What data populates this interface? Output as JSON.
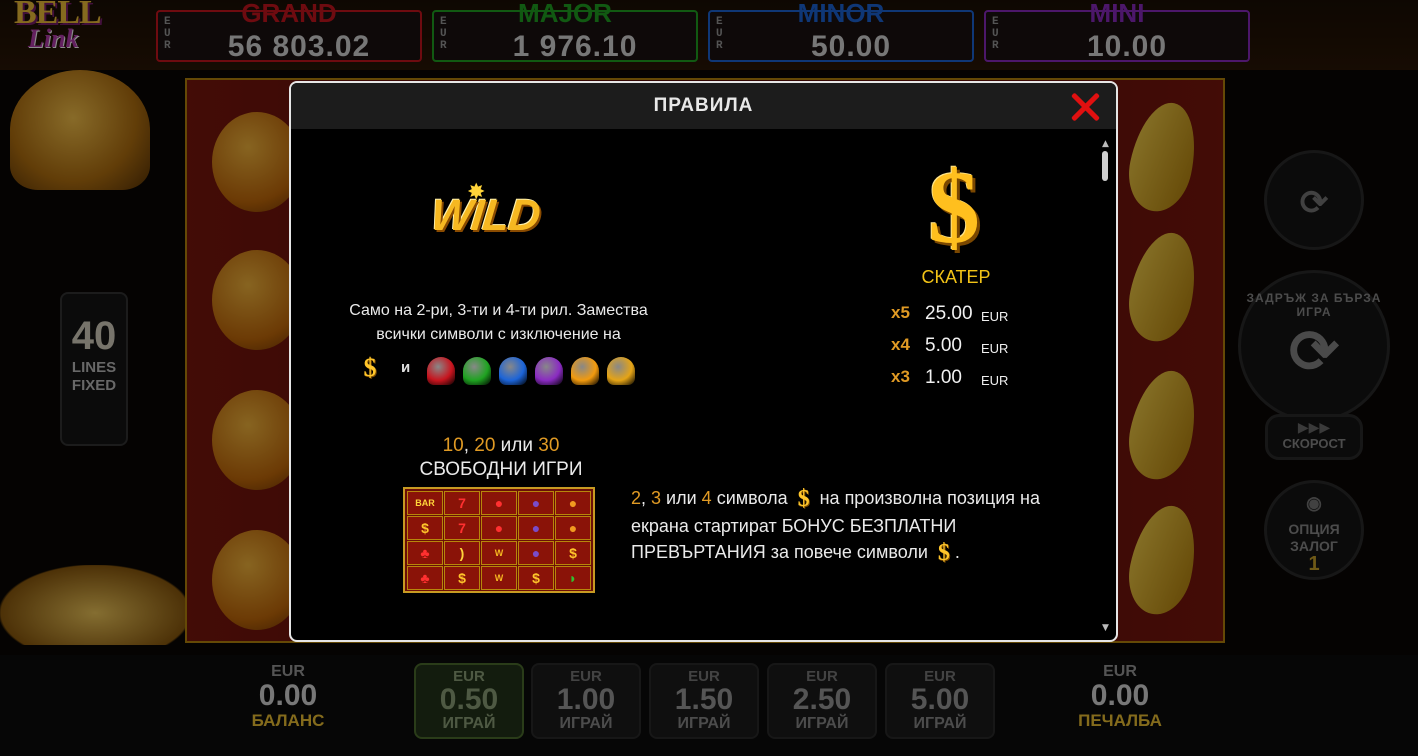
{
  "game": {
    "logo_line1": "BELL",
    "logo_line2": "Link"
  },
  "jackpots": [
    {
      "name": "GRAND",
      "currency": "EUR",
      "value": "56 803.02",
      "color": "#c8141e"
    },
    {
      "name": "MAJOR",
      "currency": "EUR",
      "value": "1 976.10",
      "color": "#1fa321"
    },
    {
      "name": "MINOR",
      "currency": "EUR",
      "value": "50.00",
      "color": "#1c64d8"
    },
    {
      "name": "MINI",
      "currency": "EUR",
      "value": "10.00",
      "color": "#8a2bc2"
    }
  ],
  "lines": {
    "count": "40",
    "label1": "LINES",
    "label2": "FIXED"
  },
  "controls": {
    "fast_play": "ЗАДРЪЖ ЗА БЪРЗА ИГРА",
    "speed": "СКОРОСТ",
    "bet_option_label1": "ОПЦИЯ",
    "bet_option_label2": "ЗАЛОГ",
    "bet_option_value": "1"
  },
  "bottom": {
    "balance": {
      "currency": "EUR",
      "value": "0.00",
      "label": "БАЛАНС"
    },
    "win": {
      "currency": "EUR",
      "value": "0.00",
      "label": "ПЕЧАЛБА"
    },
    "bets": [
      {
        "currency": "EUR",
        "value": "0.50",
        "label": "ИГРАЙ",
        "selected": true
      },
      {
        "currency": "EUR",
        "value": "1.00",
        "label": "ИГРАЙ",
        "selected": false
      },
      {
        "currency": "EUR",
        "value": "1.50",
        "label": "ИГРАЙ",
        "selected": false
      },
      {
        "currency": "EUR",
        "value": "2.50",
        "label": "ИГРАЙ",
        "selected": false
      },
      {
        "currency": "EUR",
        "value": "5.00",
        "label": "ИГРАЙ",
        "selected": false
      }
    ]
  },
  "modal": {
    "title": "ПРАВИЛА",
    "wild": {
      "logo": "WILD",
      "desc_line1": "Само на 2-ри, 3-ти и 4-ти рил. Замества",
      "desc_line2": "всички символи с изключение на",
      "and": "и",
      "bell_colors": [
        "#c8141e",
        "#1fa321",
        "#1c64d8",
        "#8a2bc2",
        "#f29a0e",
        "#e5a416"
      ]
    },
    "scatter": {
      "symbol": "$",
      "label": "СКАТЕР",
      "pays": [
        {
          "mult": "x5",
          "value": "25.00",
          "currency": "EUR"
        },
        {
          "mult": "x4",
          "value": "5.00",
          "currency": "EUR"
        },
        {
          "mult": "x3",
          "value": "1.00",
          "currency": "EUR"
        }
      ]
    },
    "free_games": {
      "n1": "10",
      "sep": ", ",
      "n2": "20",
      "or": " или ",
      "n3": "30",
      "title": "СВОБОДНИ ИГРИ"
    },
    "bonus": {
      "n1": "2",
      "sep": ", ",
      "n2": "3",
      "or": " или ",
      "n3": "4",
      "text1": " символа ",
      "text2": " на произволна позиция на екрана стартират БОНУС БЕЗПЛАТНИ ПРЕВЪРТАНИЯ за повече символи ",
      "end": "."
    }
  }
}
